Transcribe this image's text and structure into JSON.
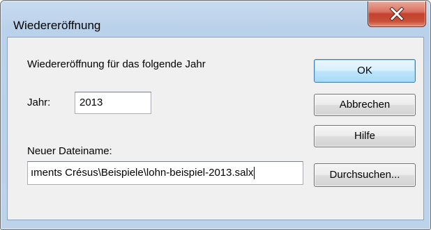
{
  "window": {
    "title": "Wiedereröffnung"
  },
  "form": {
    "description": "Wiedereröffnung für das folgende Jahr",
    "year_label": "Jahr:",
    "year_value": "2013",
    "filename_label": "Neuer Dateiname:",
    "filename_value": "ıments Crésus\\Beispiele\\lohn-beispiel-2013.salx"
  },
  "buttons": {
    "ok": "OK",
    "cancel": "Abbrechen",
    "help": "Hilfe",
    "browse": "Durchsuchen..."
  },
  "icons": {
    "close": "close-icon"
  }
}
